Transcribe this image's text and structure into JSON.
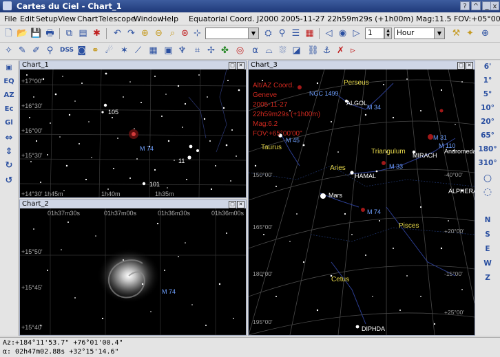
{
  "window": {
    "title": "Cartes du Ciel - Chart_1",
    "buttons": {
      "help": "?",
      "shade": "^",
      "minimize": "_",
      "close": "x"
    }
  },
  "menubar": {
    "items": [
      "File",
      "Edit",
      "Setup",
      "View",
      "Chart",
      "Telescope",
      "Window",
      "Help"
    ],
    "status": "Equatorial Coord. J2000 2005-11-27 22h59m29s (+1h00m) Mag:11.5 FOV:+05°00'00\""
  },
  "toolbar": {
    "object_combo": "",
    "timestep_value": "1",
    "timestep_unit": "Hour",
    "dss_label": "DSS"
  },
  "leftbar": [
    "EQ",
    "AZ",
    "Ec",
    "Gl"
  ],
  "rightbar": {
    "fov": [
      "6'",
      "1°",
      "5°",
      "10°",
      "20°",
      "65°",
      "180°",
      "310°"
    ],
    "directions": [
      "N",
      "S",
      "E",
      "W",
      "Z"
    ]
  },
  "chart1": {
    "title": "Chart_1",
    "labels": {
      "dec_a": "+17°00'",
      "dec_b": "+16°30'",
      "dec_c": "+16°00'",
      "dec_d": "+15°30'",
      "ra_a": "+14°30' 1h45m",
      "ra_b": "1h40m",
      "ra_c": "1h35m",
      "m74": "M 74",
      "n105": "105",
      "n101": "101",
      "n11": "11"
    }
  },
  "chart2": {
    "title": "Chart_2",
    "labels": {
      "ra1": "01h37m30s",
      "ra2": "01h37m00s",
      "ra3": "01h36m30s",
      "ra4": "01h36m00s",
      "dec1": "+15°50'",
      "dec2": "+15°45'",
      "dec3": "+15°40'",
      "m74": "M 74"
    }
  },
  "chart3": {
    "title": "Chart_3",
    "info": [
      "Alt/AZ Coord.",
      "Geneve",
      "2005-11-27",
      "22h59m29s (+1h00m)",
      "Mag:6.2",
      "FOV:+65°00'00\""
    ],
    "objects": {
      "perseus": "Perseus",
      "ngc1499": "NGC 1499",
      "algol": "ALGOL",
      "m34": "M 34",
      "m45": "M 45",
      "taurus": "Taurus",
      "triangulum": "Triangulum",
      "mirach": "MIRACH",
      "andromeda": "Andromeda",
      "m31": "M 31",
      "m110": "M 110",
      "m33": "M 33",
      "aries": "Aries",
      "hamal": "HAMAL",
      "alpheratz": "ALPHERATZ",
      "mars": "Mars",
      "m74": "M 74",
      "pisces": "Pisces",
      "cetus": "Cetus",
      "diphda": "DIPHDA"
    },
    "grid": {
      "g1": "150°00'",
      "g2": "-40°00'",
      "g3": "165°00'",
      "g4": "+20°00'",
      "g5": "180°00'",
      "g6": "-15°00'",
      "g7": "195°00'",
      "g8": "+25°00'"
    }
  },
  "statusbar": {
    "line1": "Az:+184°11'53.7\" +76°01'00.4\"",
    "line2": "α: 02h47m02.88s +32°15'14.6\""
  },
  "colors": {
    "chart_bg": "#000000",
    "info_red": "#d0291f",
    "constellation_yellow": "#e6d84a",
    "star_label": "#ffffff",
    "object_blue": "#6fa0ff"
  }
}
